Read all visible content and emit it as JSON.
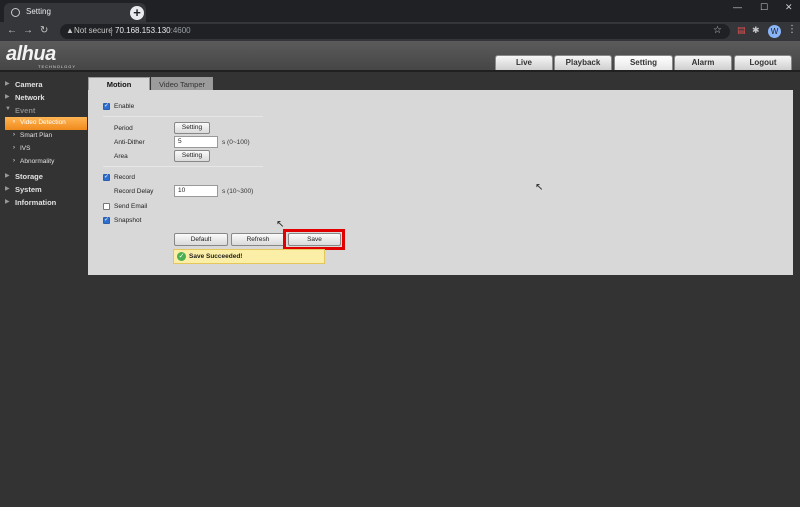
{
  "browser": {
    "tab_title": "Setting",
    "tab_close": "×",
    "new_tab": "+",
    "not_secure": "Not secure",
    "url_host": "70.168.153.130",
    "url_port": ":4600",
    "window_controls": [
      "—",
      "☐",
      "✕"
    ],
    "profile_initial": "W"
  },
  "brand": {
    "logo": "alhua",
    "logo_sub": "TECHNOLOGY"
  },
  "top_tabs": [
    {
      "label": "Live"
    },
    {
      "label": "Playback"
    },
    {
      "label": "Setting"
    },
    {
      "label": "Alarm"
    },
    {
      "label": "Logout"
    }
  ],
  "sidebar": {
    "items": [
      {
        "label": "Camera"
      },
      {
        "label": "Network"
      },
      {
        "label": "Event"
      },
      {
        "label": "Video Detection"
      },
      {
        "label": "Smart Plan"
      },
      {
        "label": "IVS"
      },
      {
        "label": "Abnormality"
      },
      {
        "label": "Storage"
      },
      {
        "label": "System"
      },
      {
        "label": "Information"
      }
    ]
  },
  "content_tabs": [
    {
      "label": "Motion Detection"
    },
    {
      "label": "Video Tamper"
    }
  ],
  "form": {
    "enable_label": "Enable",
    "period_label": "Period",
    "period_button": "Setting",
    "anti_dither_label": "Anti-Dither",
    "anti_dither_value": "5",
    "anti_dither_unit": "s (0~100)",
    "area_label": "Area",
    "area_button": "Setting",
    "record_label": "Record",
    "record_delay_label": "Record Delay",
    "record_delay_value": "10",
    "record_delay_unit": "s (10~300)",
    "send_email_label": "Send Email",
    "snapshot_label": "Snapshot",
    "default_button": "Default",
    "refresh_button": "Refresh",
    "save_button": "Save",
    "toast_message": "Save Succeeded!"
  }
}
